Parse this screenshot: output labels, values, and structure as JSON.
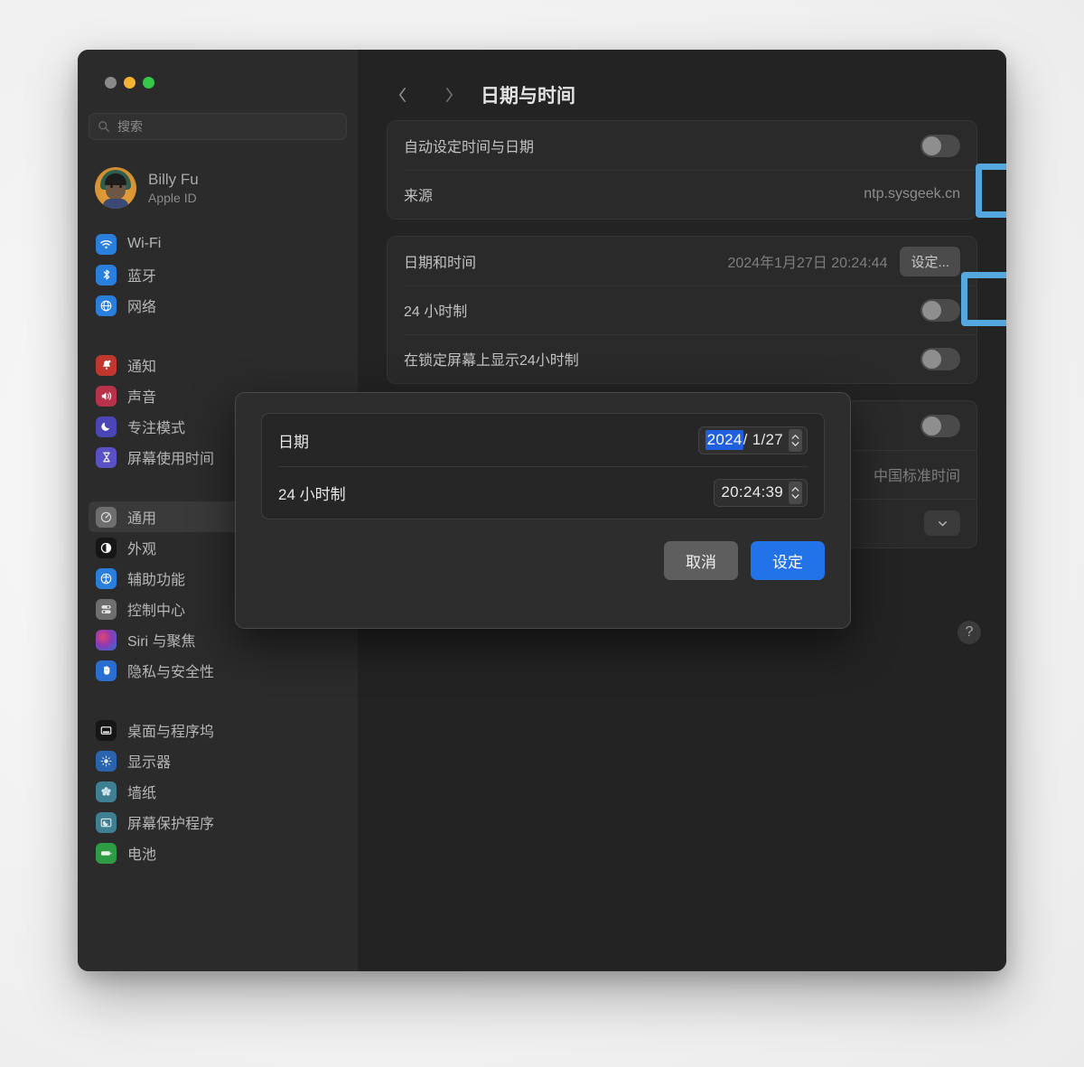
{
  "window": {
    "traffic_lights": [
      "close",
      "minimize",
      "maximize"
    ]
  },
  "sidebar": {
    "search": {
      "placeholder": "搜索",
      "value": "",
      "icon": "search-icon"
    },
    "account": {
      "name": "Billy Fu",
      "subtitle": "Apple ID",
      "icon": "avatar"
    },
    "groups": [
      {
        "items": [
          {
            "label": "Wi-Fi",
            "icon": "wifi-icon",
            "selected": false
          },
          {
            "label": "蓝牙",
            "icon": "bluetooth-icon",
            "selected": false
          },
          {
            "label": "网络",
            "icon": "network-globe-icon",
            "selected": false
          }
        ]
      },
      {
        "items": [
          {
            "label": "通知",
            "icon": "bell-icon",
            "selected": false
          },
          {
            "label": "声音",
            "icon": "speaker-icon",
            "selected": false
          },
          {
            "label": "专注模式",
            "icon": "moon-icon",
            "selected": false
          },
          {
            "label": "屏幕使用时间",
            "icon": "hourglass-icon",
            "selected": false
          }
        ]
      },
      {
        "items": [
          {
            "label": "通用",
            "icon": "gear-icon",
            "selected": true
          },
          {
            "label": "外观",
            "icon": "appearance-icon",
            "selected": false
          },
          {
            "label": "辅助功能",
            "icon": "accessibility-icon",
            "selected": false
          },
          {
            "label": "控制中心",
            "icon": "control-center-icon",
            "selected": false
          },
          {
            "label": "Siri 与聚焦",
            "icon": "siri-icon",
            "selected": false
          },
          {
            "label": "隐私与安全性",
            "icon": "privacy-hand-icon",
            "selected": false
          }
        ]
      },
      {
        "items": [
          {
            "label": "桌面与程序坞",
            "icon": "desktop-dock-icon",
            "selected": false
          },
          {
            "label": "显示器",
            "icon": "display-icon",
            "selected": false
          },
          {
            "label": "墙纸",
            "icon": "wallpaper-icon",
            "selected": false
          },
          {
            "label": "屏幕保护程序",
            "icon": "screensaver-icon",
            "selected": false
          },
          {
            "label": "电池",
            "icon": "battery-icon",
            "selected": false
          }
        ]
      }
    ]
  },
  "main": {
    "nav": {
      "back_icon": "chevron-left-icon",
      "forward_icon": "chevron-right-icon"
    },
    "title": "日期与时间",
    "cards": [
      {
        "rows": [
          {
            "label": "自动设定时间与日期",
            "control": "toggle",
            "toggle_on": false
          },
          {
            "label": "来源",
            "control": "value",
            "value": "ntp.sysgeek.cn"
          }
        ]
      },
      {
        "rows": [
          {
            "label": "日期和时间",
            "control": "button",
            "value": "2024年1月27日 20:24:44",
            "button_label": "设定..."
          },
          {
            "label": "24 小时制",
            "control": "toggle",
            "toggle_on": false
          },
          {
            "label": "在锁定屏幕上显示24小时制",
            "control": "toggle",
            "toggle_on": false
          }
        ]
      },
      {
        "rows": [
          {
            "label": "",
            "control": "toggle",
            "toggle_on": false
          },
          {
            "label": "",
            "control": "value",
            "value": "中国标准时间"
          },
          {
            "label": "",
            "control": "popup",
            "value": ""
          }
        ]
      }
    ],
    "help_button": "?"
  },
  "highlights": [
    {
      "name": "auto-set-toggle-highlight",
      "color": "#55a8dd"
    },
    {
      "name": "set-button-highlight",
      "color": "#55a8dd"
    }
  ],
  "dialog": {
    "rows": [
      {
        "label": "日期",
        "field_selected": "2024",
        "field_rest": "/  1/27",
        "stepper": "stepper-date"
      },
      {
        "label": "24 小时制",
        "field_selected": "",
        "field_rest": "20:24:39",
        "stepper": "stepper-time"
      }
    ],
    "cancel_label": "取消",
    "confirm_label": "设定"
  },
  "colors": {
    "accent_blue": "#2272e8",
    "selection_blue": "#2060df",
    "highlight_cyan": "#55a8dd",
    "window_bg": "#232323",
    "sidebar_bg": "#2b2b2b",
    "card_bg": "#2a2a2a",
    "sheet_bg": "#2d2d2d"
  }
}
